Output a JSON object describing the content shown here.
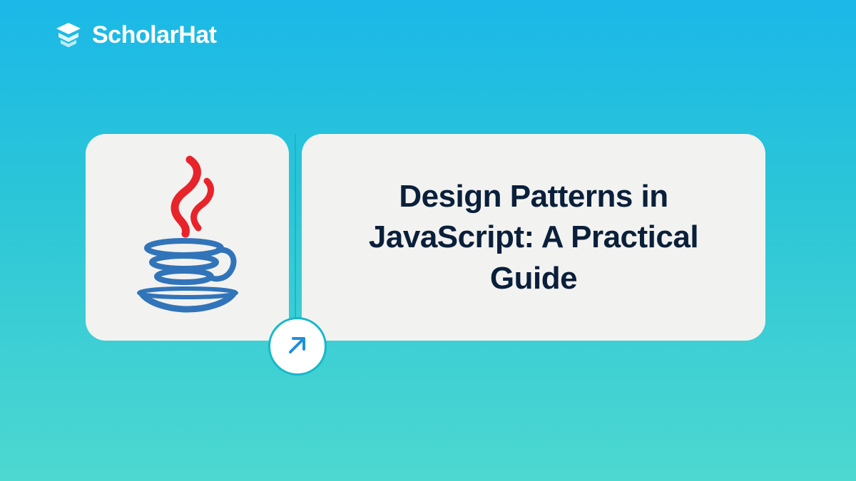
{
  "brand": {
    "name": "ScholarHat"
  },
  "content": {
    "title": "Design Patterns in JavaScript: A Practical Guide"
  },
  "icons": {
    "logo": "scholarhat-logo",
    "feature": "java-logo",
    "badge": "arrow-up-right"
  },
  "colors": {
    "gradient_start": "#1bb8e8",
    "gradient_end": "#4dd8d0",
    "card_bg": "#f2f2f0",
    "text_dark": "#0a1f3a",
    "accent": "#16b8c9",
    "java_red": "#e8242b",
    "java_blue": "#3174b9"
  }
}
